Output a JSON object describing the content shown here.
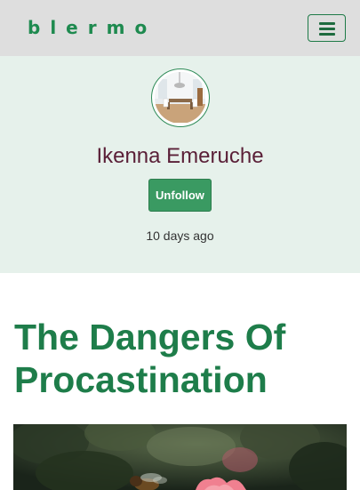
{
  "navbar": {
    "brand": "blermo",
    "menu_icon": "hamburger-menu-icon"
  },
  "profile": {
    "name": "Ikenna Emeruche",
    "follow_button_label": "Unfollow",
    "posted_time": "10 days ago",
    "accent_color": "#3a9a62"
  },
  "post": {
    "title": "The Dangers Of Procastination"
  },
  "colors": {
    "brand": "#1e8a4f",
    "profile_background": "#e6f1eb",
    "navbar_background": "#dedede",
    "name_color": "#5a1f37",
    "title_color": "#1e7d4a"
  }
}
